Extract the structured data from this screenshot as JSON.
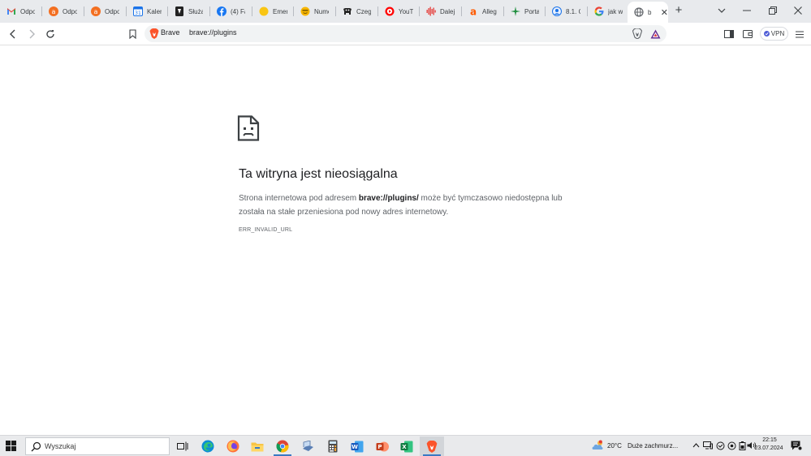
{
  "tabs": [
    {
      "title": "Odpo",
      "icon": "gmail-icon",
      "color": "#ea4335"
    },
    {
      "title": "Odpo",
      "icon": "orange-a-icon",
      "color": "#f36f21"
    },
    {
      "title": "Odpo",
      "icon": "orange-a-icon",
      "color": "#f36f21"
    },
    {
      "title": "Kalen",
      "icon": "calendar-icon",
      "color": "#1a73e8"
    },
    {
      "title": "Służa",
      "icon": "shield-doc-icon",
      "color": "#222222"
    },
    {
      "title": "(4) Fa",
      "icon": "facebook-icon",
      "color": "#1877f2"
    },
    {
      "title": "Emer",
      "icon": "yellow-circle-icon",
      "color": "#f9c513"
    },
    {
      "title": "Nume",
      "icon": "smiley-icon",
      "color": "#f7b500"
    },
    {
      "title": "Czego",
      "icon": "cow-icon",
      "color": "#222222"
    },
    {
      "title": "YouTu",
      "icon": "youtube-icon",
      "color": "#ff0000"
    },
    {
      "title": "Dalej",
      "icon": "soundwave-icon",
      "color": "#e53935"
    },
    {
      "title": "Allegr",
      "icon": "allegro-icon",
      "color": "#ff5a00"
    },
    {
      "title": "Portal",
      "icon": "star-green-icon",
      "color": "#1e8e3e"
    },
    {
      "title": "8.1. C",
      "icon": "globe-blue-icon",
      "color": "#1a73e8"
    },
    {
      "title": "jak w",
      "icon": "google-icon",
      "color": "#4285f4"
    }
  ],
  "active_tab": {
    "title": "b",
    "icon": "globe-icon",
    "close": "✕"
  },
  "newtab_label": "+",
  "window_controls": {
    "dropdown": "⌄",
    "minimize": "—",
    "restore": "❐",
    "close": "✕"
  },
  "omnibox": {
    "brave_label": "Brave",
    "url": "brave://plugins"
  },
  "vpn_label": "VPN",
  "error": {
    "title": "Ta witryna jest nieosiągalna",
    "msg_prefix": "Strona internetowa pod adresem ",
    "msg_url": "brave://plugins/",
    "msg_suffix": " może być tymczasowo niedostępna lub została na stałe przeniesiona pod nowy adres internetowy.",
    "code": "ERR_INVALID_URL"
  },
  "taskbar": {
    "search_placeholder": "Wyszukaj",
    "weather_temp": "20°C",
    "weather_desc": "Duże zachmurz...",
    "time": "22:15",
    "date": "23.07.2024"
  },
  "colors": {
    "brave_orange": "#fb542b",
    "accent_blue": "#3a79c4"
  }
}
